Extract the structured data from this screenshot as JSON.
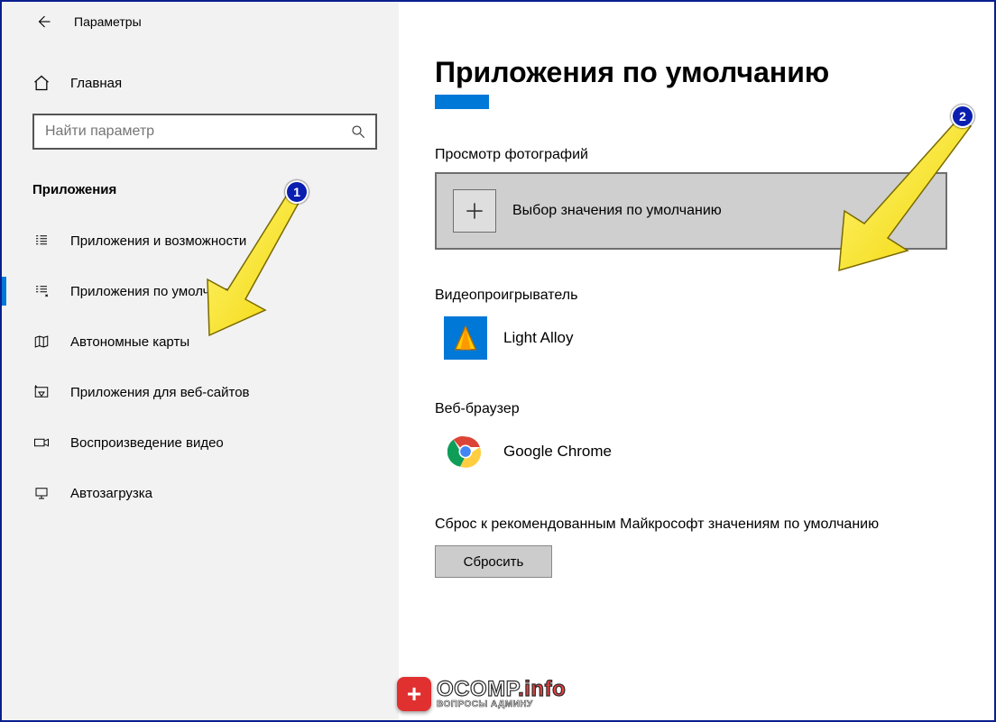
{
  "window": {
    "title": "Параметры"
  },
  "sidebar": {
    "home": "Главная",
    "search_placeholder": "Найти параметр",
    "category": "Приложения",
    "items": [
      {
        "label": "Приложения и возможности"
      },
      {
        "label": "Приложения по умолчанию"
      },
      {
        "label": "Автономные карты"
      },
      {
        "label": "Приложения для веб-сайтов"
      },
      {
        "label": "Воспроизведение видео"
      },
      {
        "label": "Автозагрузка"
      }
    ]
  },
  "main": {
    "title": "Приложения по умолчанию",
    "photo_label": "Просмотр фотографий",
    "photo_default": "Выбор значения по умолчанию",
    "video_label": "Видеопроигрыватель",
    "video_app": "Light Alloy",
    "browser_label": "Веб-браузер",
    "browser_app": "Google Chrome",
    "reset_text": "Сброс к рекомендованным Майкрософт значениям по умолчанию",
    "reset_btn": "Сбросить"
  },
  "annotations": {
    "badge1": "1",
    "badge2": "2"
  },
  "watermark": {
    "brand": "OCOMP",
    "suffix": ".info",
    "sub": "ВОПРОСЫ АДМИНУ"
  }
}
